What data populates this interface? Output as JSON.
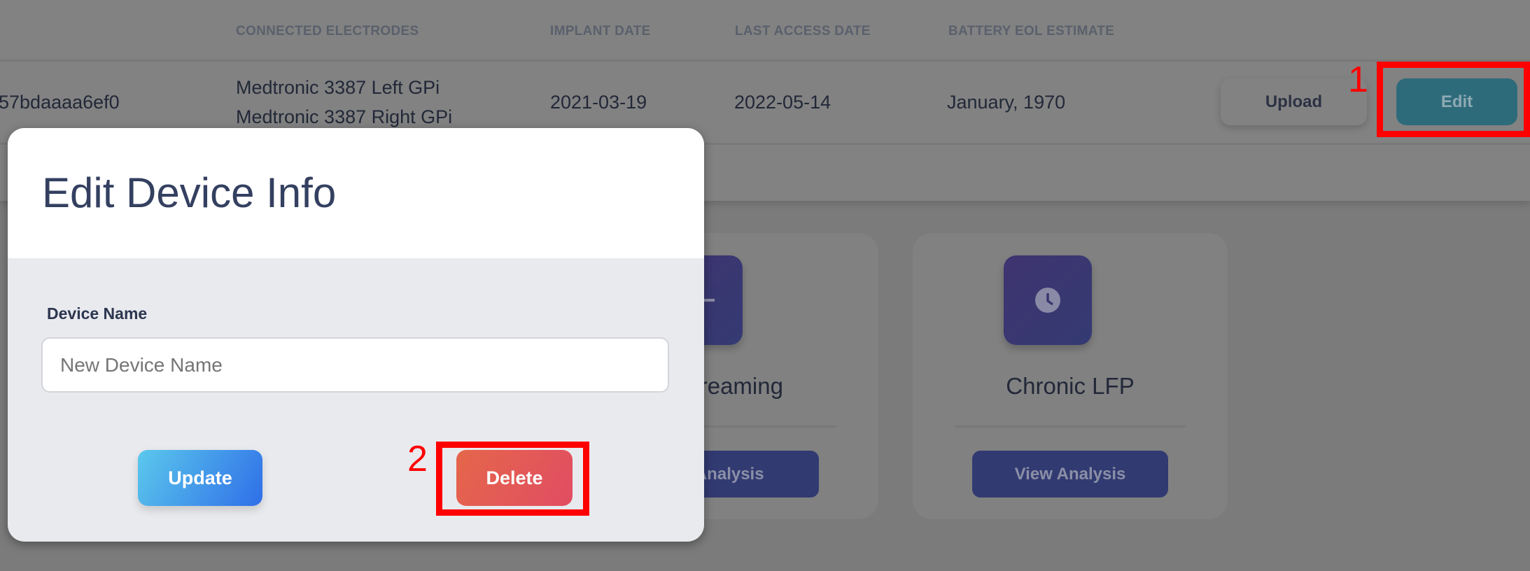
{
  "table": {
    "headers": [
      "CONNECTED ELECTRODES",
      "IMPLANT DATE",
      "LAST ACCESS DATE",
      "BATTERY EOL ESTIMATE"
    ],
    "row": {
      "device_id": "57bdaaaa6ef0",
      "electrodes": [
        "Medtronic 3387 Left GPi",
        "Medtronic 3387 Right GPi"
      ],
      "implant_date": "2021-03-19",
      "last_access_date": "2022-05-14",
      "battery_eol": "January, 1970",
      "upload_label": "Upload",
      "edit_label": "Edit"
    }
  },
  "cards": [
    {
      "title": "e Streaming",
      "button": "w Analysis"
    },
    {
      "title": "Chronic LFP",
      "button": "View Analysis"
    }
  ],
  "modal": {
    "title": "Edit Device Info",
    "field_label": "Device Name",
    "placeholder": "New Device Name",
    "update_label": "Update",
    "delete_label": "Delete"
  },
  "annotations": [
    "1",
    "2"
  ],
  "colors": {
    "annotation": "#ff0000",
    "edit": "#2e6b7a",
    "update_from": "#5bc8ec",
    "update_to": "#2f6fe8",
    "delete_from": "#e5664a",
    "delete_to": "#e14d63"
  }
}
